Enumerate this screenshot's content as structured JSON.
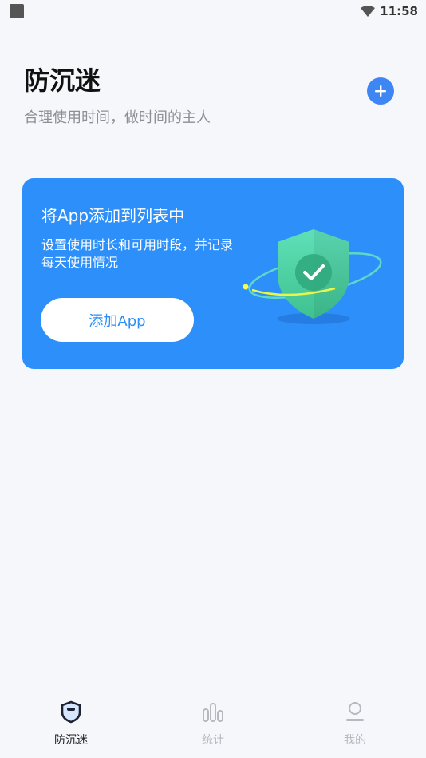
{
  "status_bar": {
    "time": "11:58"
  },
  "header": {
    "title": "防沉迷",
    "subtitle": "合理使用时间，做时间的主人"
  },
  "card": {
    "title": "将App添加到列表中",
    "description": "设置使用时长和可用时段，并记录每天使用情况",
    "button_label": "添加App"
  },
  "bottom_nav": {
    "items": [
      {
        "label": "防沉迷",
        "icon": "shield-icon",
        "active": true
      },
      {
        "label": "统计",
        "icon": "bar-chart-icon",
        "active": false
      },
      {
        "label": "我的",
        "icon": "person-icon",
        "active": false
      }
    ]
  },
  "colors": {
    "accent": "#2d8ff9",
    "fab": "#3f86f5",
    "background": "#f6f7fb"
  }
}
